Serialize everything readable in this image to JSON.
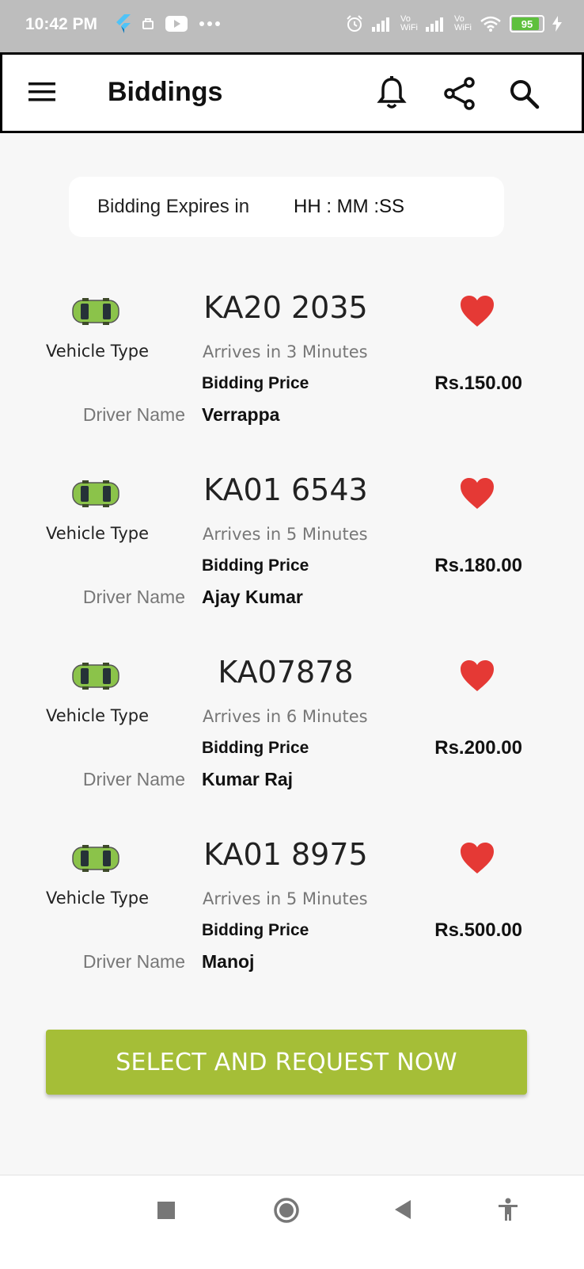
{
  "status_bar": {
    "time": "10:42 PM",
    "battery": "95",
    "vowifi_1": "Vo\nWiFi",
    "vowifi_2": "Vo\nWiFi"
  },
  "appbar": {
    "title": "Biddings"
  },
  "timer": {
    "label": "Bidding Expires in",
    "value": "HH : MM :SS"
  },
  "colors": {
    "accent": "#a5be37",
    "heart": "#e53935",
    "car": "#8bc34a"
  },
  "bids": [
    {
      "vehicle_type_label": "Vehicle Type",
      "plate": "KA20 2035",
      "arrives": "Arrives in 3 Minutes",
      "bidding_price_label": "Bidding Price",
      "price": "Rs.150.00",
      "driver_name_label": "Driver Name",
      "driver_name": "Verrappa"
    },
    {
      "vehicle_type_label": "Vehicle Type",
      "plate": "KA01 6543",
      "arrives": "Arrives in 5 Minutes",
      "bidding_price_label": "Bidding Price",
      "price": "Rs.180.00",
      "driver_name_label": "Driver Name",
      "driver_name": "Ajay Kumar"
    },
    {
      "vehicle_type_label": "Vehicle Type",
      "plate": "KA07878",
      "arrives": "Arrives in 6 Minutes",
      "bidding_price_label": "Bidding Price",
      "price": "Rs.200.00",
      "driver_name_label": "Driver Name",
      "driver_name": "Kumar Raj"
    },
    {
      "vehicle_type_label": "Vehicle Type",
      "plate": "KA01 8975",
      "arrives": "Arrives in 5 Minutes",
      "bidding_price_label": "Bidding Price",
      "price": "Rs.500.00",
      "driver_name_label": "Driver Name",
      "driver_name": "Manoj"
    }
  ],
  "cta": {
    "label": "SELECT AND REQUEST NOW"
  }
}
